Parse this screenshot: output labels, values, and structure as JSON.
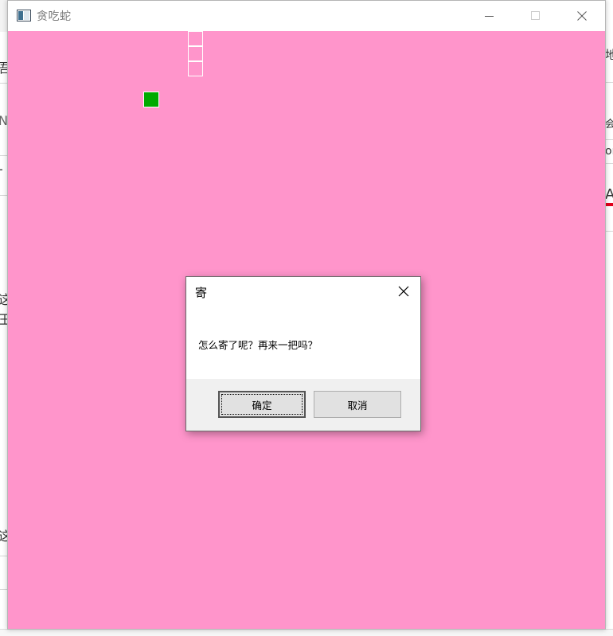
{
  "window": {
    "title": "贪吃蛇"
  },
  "colors": {
    "canvas_bg": "#ff95cb",
    "food": "#00aa00",
    "snake_outline": "#ffffff"
  },
  "icons": {
    "app": "app-window-icon",
    "minimize": "minimize-icon",
    "maximize": "maximize-icon",
    "close": "close-icon"
  },
  "dialog": {
    "title": "寄",
    "message": "怎么寄了呢？再来一把吗？",
    "ok_label": "确定",
    "cancel_label": "取消"
  },
  "background": {
    "left_fragments": [
      "吾",
      "N",
      "-",
      "这",
      "王",
      "这"
    ],
    "right_fragments": [
      "地",
      "会",
      "or",
      "A"
    ]
  }
}
